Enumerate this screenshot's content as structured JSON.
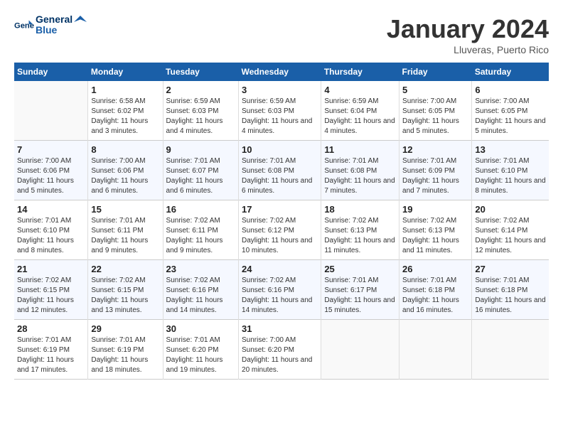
{
  "header": {
    "logo_general": "General",
    "logo_blue": "Blue",
    "month_title": "January 2024",
    "location": "Lluveras, Puerto Rico"
  },
  "days_of_week": [
    "Sunday",
    "Monday",
    "Tuesday",
    "Wednesday",
    "Thursday",
    "Friday",
    "Saturday"
  ],
  "weeks": [
    [
      {
        "day": "",
        "sunrise": "",
        "sunset": "",
        "daylight": ""
      },
      {
        "day": "1",
        "sunrise": "Sunrise: 6:58 AM",
        "sunset": "Sunset: 6:02 PM",
        "daylight": "Daylight: 11 hours and 3 minutes."
      },
      {
        "day": "2",
        "sunrise": "Sunrise: 6:59 AM",
        "sunset": "Sunset: 6:03 PM",
        "daylight": "Daylight: 11 hours and 4 minutes."
      },
      {
        "day": "3",
        "sunrise": "Sunrise: 6:59 AM",
        "sunset": "Sunset: 6:03 PM",
        "daylight": "Daylight: 11 hours and 4 minutes."
      },
      {
        "day": "4",
        "sunrise": "Sunrise: 6:59 AM",
        "sunset": "Sunset: 6:04 PM",
        "daylight": "Daylight: 11 hours and 4 minutes."
      },
      {
        "day": "5",
        "sunrise": "Sunrise: 7:00 AM",
        "sunset": "Sunset: 6:05 PM",
        "daylight": "Daylight: 11 hours and 5 minutes."
      },
      {
        "day": "6",
        "sunrise": "Sunrise: 7:00 AM",
        "sunset": "Sunset: 6:05 PM",
        "daylight": "Daylight: 11 hours and 5 minutes."
      }
    ],
    [
      {
        "day": "7",
        "sunrise": "Sunrise: 7:00 AM",
        "sunset": "Sunset: 6:06 PM",
        "daylight": "Daylight: 11 hours and 5 minutes."
      },
      {
        "day": "8",
        "sunrise": "Sunrise: 7:00 AM",
        "sunset": "Sunset: 6:06 PM",
        "daylight": "Daylight: 11 hours and 6 minutes."
      },
      {
        "day": "9",
        "sunrise": "Sunrise: 7:01 AM",
        "sunset": "Sunset: 6:07 PM",
        "daylight": "Daylight: 11 hours and 6 minutes."
      },
      {
        "day": "10",
        "sunrise": "Sunrise: 7:01 AM",
        "sunset": "Sunset: 6:08 PM",
        "daylight": "Daylight: 11 hours and 6 minutes."
      },
      {
        "day": "11",
        "sunrise": "Sunrise: 7:01 AM",
        "sunset": "Sunset: 6:08 PM",
        "daylight": "Daylight: 11 hours and 7 minutes."
      },
      {
        "day": "12",
        "sunrise": "Sunrise: 7:01 AM",
        "sunset": "Sunset: 6:09 PM",
        "daylight": "Daylight: 11 hours and 7 minutes."
      },
      {
        "day": "13",
        "sunrise": "Sunrise: 7:01 AM",
        "sunset": "Sunset: 6:10 PM",
        "daylight": "Daylight: 11 hours and 8 minutes."
      }
    ],
    [
      {
        "day": "14",
        "sunrise": "Sunrise: 7:01 AM",
        "sunset": "Sunset: 6:10 PM",
        "daylight": "Daylight: 11 hours and 8 minutes."
      },
      {
        "day": "15",
        "sunrise": "Sunrise: 7:01 AM",
        "sunset": "Sunset: 6:11 PM",
        "daylight": "Daylight: 11 hours and 9 minutes."
      },
      {
        "day": "16",
        "sunrise": "Sunrise: 7:02 AM",
        "sunset": "Sunset: 6:11 PM",
        "daylight": "Daylight: 11 hours and 9 minutes."
      },
      {
        "day": "17",
        "sunrise": "Sunrise: 7:02 AM",
        "sunset": "Sunset: 6:12 PM",
        "daylight": "Daylight: 11 hours and 10 minutes."
      },
      {
        "day": "18",
        "sunrise": "Sunrise: 7:02 AM",
        "sunset": "Sunset: 6:13 PM",
        "daylight": "Daylight: 11 hours and 11 minutes."
      },
      {
        "day": "19",
        "sunrise": "Sunrise: 7:02 AM",
        "sunset": "Sunset: 6:13 PM",
        "daylight": "Daylight: 11 hours and 11 minutes."
      },
      {
        "day": "20",
        "sunrise": "Sunrise: 7:02 AM",
        "sunset": "Sunset: 6:14 PM",
        "daylight": "Daylight: 11 hours and 12 minutes."
      }
    ],
    [
      {
        "day": "21",
        "sunrise": "Sunrise: 7:02 AM",
        "sunset": "Sunset: 6:15 PM",
        "daylight": "Daylight: 11 hours and 12 minutes."
      },
      {
        "day": "22",
        "sunrise": "Sunrise: 7:02 AM",
        "sunset": "Sunset: 6:15 PM",
        "daylight": "Daylight: 11 hours and 13 minutes."
      },
      {
        "day": "23",
        "sunrise": "Sunrise: 7:02 AM",
        "sunset": "Sunset: 6:16 PM",
        "daylight": "Daylight: 11 hours and 14 minutes."
      },
      {
        "day": "24",
        "sunrise": "Sunrise: 7:02 AM",
        "sunset": "Sunset: 6:16 PM",
        "daylight": "Daylight: 11 hours and 14 minutes."
      },
      {
        "day": "25",
        "sunrise": "Sunrise: 7:01 AM",
        "sunset": "Sunset: 6:17 PM",
        "daylight": "Daylight: 11 hours and 15 minutes."
      },
      {
        "day": "26",
        "sunrise": "Sunrise: 7:01 AM",
        "sunset": "Sunset: 6:18 PM",
        "daylight": "Daylight: 11 hours and 16 minutes."
      },
      {
        "day": "27",
        "sunrise": "Sunrise: 7:01 AM",
        "sunset": "Sunset: 6:18 PM",
        "daylight": "Daylight: 11 hours and 16 minutes."
      }
    ],
    [
      {
        "day": "28",
        "sunrise": "Sunrise: 7:01 AM",
        "sunset": "Sunset: 6:19 PM",
        "daylight": "Daylight: 11 hours and 17 minutes."
      },
      {
        "day": "29",
        "sunrise": "Sunrise: 7:01 AM",
        "sunset": "Sunset: 6:19 PM",
        "daylight": "Daylight: 11 hours and 18 minutes."
      },
      {
        "day": "30",
        "sunrise": "Sunrise: 7:01 AM",
        "sunset": "Sunset: 6:20 PM",
        "daylight": "Daylight: 11 hours and 19 minutes."
      },
      {
        "day": "31",
        "sunrise": "Sunrise: 7:00 AM",
        "sunset": "Sunset: 6:20 PM",
        "daylight": "Daylight: 11 hours and 20 minutes."
      },
      {
        "day": "",
        "sunrise": "",
        "sunset": "",
        "daylight": ""
      },
      {
        "day": "",
        "sunrise": "",
        "sunset": "",
        "daylight": ""
      },
      {
        "day": "",
        "sunrise": "",
        "sunset": "",
        "daylight": ""
      }
    ]
  ]
}
